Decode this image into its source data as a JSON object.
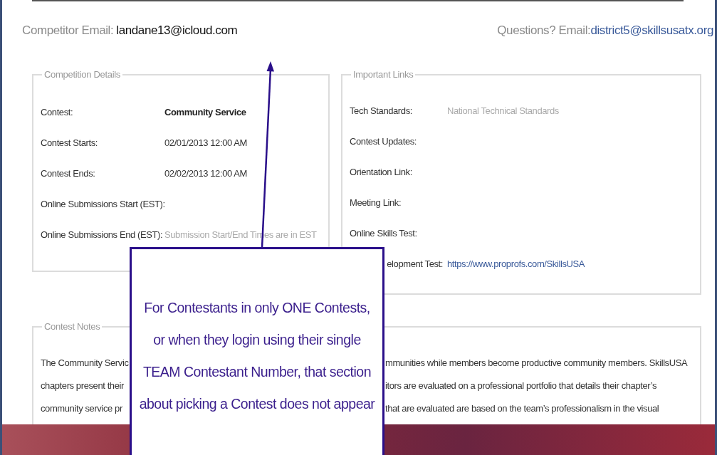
{
  "header": {
    "competitor_label": "Competitor Email:",
    "competitor_email": "landane13@icloud.com",
    "questions_label": "Questions? Email:",
    "questions_email": "district5@skillsusatx.org"
  },
  "competition_details": {
    "legend": "Competition Details",
    "rows": [
      {
        "label": "Contest:",
        "value": "Community Service",
        "kind": "bold"
      },
      {
        "label": "Contest Starts:",
        "value": "02/01/2013 12:00 AM",
        "kind": "plain"
      },
      {
        "label": "Contest Ends:",
        "value": "02/02/2013 12:00 AM",
        "kind": "plain"
      },
      {
        "label": "Online Submissions Start (EST):",
        "kind": "plain"
      },
      {
        "label": "Online Submissions End (EST):",
        "value": "Submission Start/End Times are in EST",
        "kind": "muted"
      }
    ]
  },
  "important_links": {
    "legend": "Important Links",
    "rows": [
      {
        "label": "Tech Standards:",
        "value": "National Technical Standards",
        "kind": "muted"
      },
      {
        "label": "Contest Updates:",
        "kind": "plain"
      },
      {
        "label": "Orientation Link:",
        "kind": "plain"
      },
      {
        "label": "Meeting Link:",
        "kind": "plain"
      },
      {
        "label": "Online Skills Test:",
        "kind": "plain"
      },
      {
        "label": "elopment Test:",
        "value": "https://www.proprofs.com/SkillsUSA",
        "kind": "link",
        "label_cut": true
      }
    ]
  },
  "contest_notes": {
    "legend": "Contest Notes",
    "lines": [
      {
        "start": "The Community Servic",
        "end": "mmunities while members become productive community members. SkillsUSA"
      },
      {
        "start": "chapters present their",
        "end": "itors are evaluated on a professional portfolio that details their chapter’s"
      },
      {
        "start": "community service pr",
        "end": "that are evaluated are based on the team’s professionalism in the visual"
      }
    ]
  },
  "callout": {
    "text": "For Contestants in only ONE Contests,\nor when they login using their single\nTEAM Contestant Number, that section\nabout picking a Contest does not appear"
  }
}
